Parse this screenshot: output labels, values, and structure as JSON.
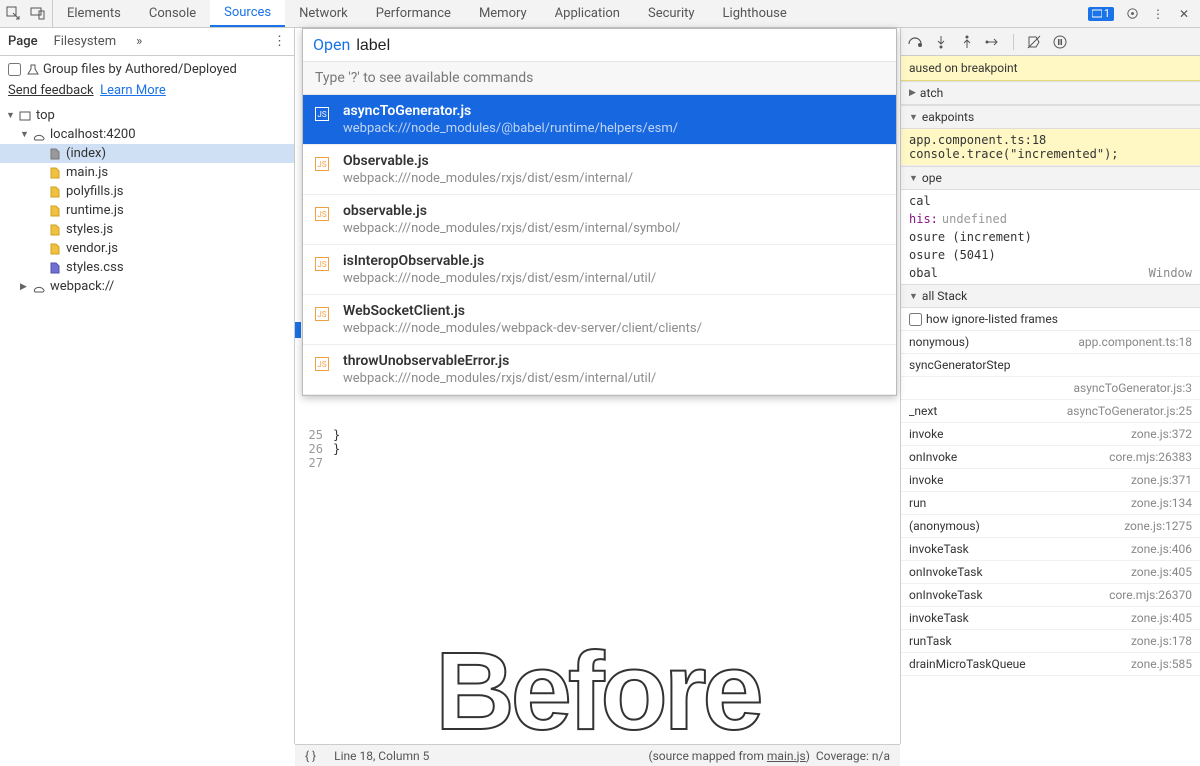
{
  "topTabs": [
    "Elements",
    "Console",
    "Sources",
    "Network",
    "Performance",
    "Memory",
    "Application",
    "Security",
    "Lighthouse"
  ],
  "activeTopTab": "Sources",
  "issuesBadge": "1",
  "leftTabs": {
    "page": "Page",
    "filesystem": "Filesystem"
  },
  "groupLabel": "Group files by Authored/Deployed",
  "sendFeedback": "Send feedback",
  "learnMore": "Learn More",
  "tree": {
    "top": "top",
    "host": "localhost:4200",
    "files": [
      "(index)",
      "main.js",
      "polyfills.js",
      "runtime.js",
      "styles.js",
      "vendor.js",
      "styles.css"
    ],
    "webpack": "webpack://"
  },
  "quickOpen": {
    "prefix": "Open",
    "query": "label",
    "hint": "Type '?' to see available commands",
    "items": [
      {
        "fn": "asyncToGenerator.js",
        "fp": "webpack:///node_modules/@babel/runtime/helpers/esm/",
        "sel": true
      },
      {
        "fn": "Observable.js",
        "fp": "webpack:///node_modules/rxjs/dist/esm/internal/"
      },
      {
        "fn": "observable.js",
        "fp": "webpack:///node_modules/rxjs/dist/esm/internal/symbol/"
      },
      {
        "fn": "isInteropObservable.js",
        "fp": "webpack:///node_modules/rxjs/dist/esm/internal/util/"
      },
      {
        "fn": "WebSocketClient.js",
        "fp": "webpack:///node_modules/webpack-dev-server/client/clients/"
      },
      {
        "fn": "throwUnobservableError.js",
        "fp": "webpack:///node_modules/rxjs/dist/esm/internal/util/"
      }
    ]
  },
  "codeLines": [
    {
      "num": "25",
      "text": "  }"
    },
    {
      "num": "26",
      "text": "}"
    },
    {
      "num": "27",
      "text": ""
    }
  ],
  "bigLabel": "Before",
  "rightPanel": {
    "banner": "aused on breakpoint",
    "watch": "atch",
    "breakpoints": "eakpoints",
    "bpFile": "app.component.ts:18",
    "bpCode": "console.trace(\"incremented\");",
    "scopeH": "ope",
    "scopeLocal": "cal",
    "thisKey": "his:",
    "thisVal": "undefined",
    "closure1": "osure (increment)",
    "closure2": "osure (5041)",
    "global": "obal",
    "globalVal": "Window",
    "callStackH": "all Stack",
    "showIgnoreListed": "how ignore-listed frames",
    "stack": [
      {
        "fn": "nonymous)",
        "loc": "app.component.ts:18"
      },
      {
        "fn": "syncGeneratorStep",
        "loc": ""
      },
      {
        "fn": "",
        "loc": "asyncToGenerator.js:3"
      },
      {
        "fn": "_next",
        "loc": "asyncToGenerator.js:25"
      },
      {
        "fn": "invoke",
        "loc": "zone.js:372"
      },
      {
        "fn": "onInvoke",
        "loc": "core.mjs:26383"
      },
      {
        "fn": "invoke",
        "loc": "zone.js:371"
      },
      {
        "fn": "run",
        "loc": "zone.js:134"
      },
      {
        "fn": "(anonymous)",
        "loc": "zone.js:1275"
      },
      {
        "fn": "invokeTask",
        "loc": "zone.js:406"
      },
      {
        "fn": "onInvokeTask",
        "loc": "zone.js:405"
      },
      {
        "fn": "onInvokeTask",
        "loc": "core.mjs:26370"
      },
      {
        "fn": "invokeTask",
        "loc": "zone.js:405"
      },
      {
        "fn": "runTask",
        "loc": "zone.js:178"
      },
      {
        "fn": "drainMicroTaskQueue",
        "loc": "zone.js:585"
      }
    ]
  },
  "statusBar": {
    "pos": "Line 18, Column 5",
    "mapped": "(source mapped from ",
    "mappedFile": "main.js",
    "mappedEnd": ")",
    "coverage": "Coverage: n/a"
  }
}
